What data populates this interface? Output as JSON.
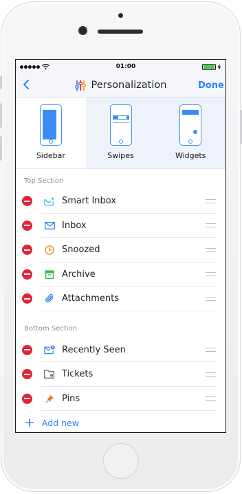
{
  "status": {
    "time": "01:00"
  },
  "nav": {
    "back_icon": "chevron-left-icon",
    "title": "Personalization",
    "done": "Done"
  },
  "modes": [
    {
      "label": "Sidebar",
      "selected": true
    },
    {
      "label": "Swipes",
      "selected": false
    },
    {
      "label": "Widgets",
      "selected": false
    }
  ],
  "top_section": {
    "title": "Top Section",
    "items": [
      {
        "label": "Smart Inbox",
        "icon": "smart-inbox-icon",
        "color": "#2ec3e6"
      },
      {
        "label": "Inbox",
        "icon": "inbox-icon",
        "color": "#3d8bf5"
      },
      {
        "label": "Snoozed",
        "icon": "clock-icon",
        "color": "#f08a1c"
      },
      {
        "label": "Archive",
        "icon": "archive-icon",
        "color": "#2fbf4a"
      },
      {
        "label": "Attachments",
        "icon": "paperclip-icon",
        "color": "#3d8bf5"
      }
    ]
  },
  "bottom_section": {
    "title": "Bottom Section",
    "items": [
      {
        "label": "Recently Seen",
        "icon": "recently-seen-icon",
        "color": "#3d8bf5"
      },
      {
        "label": "Tickets",
        "icon": "folder-icon",
        "color": "#6b7280"
      },
      {
        "label": "Pins",
        "icon": "pin-icon",
        "color": "#f0772a"
      }
    ]
  },
  "add_new": "Add new",
  "colors": {
    "accent": "#2f82f4",
    "delete": "#e0253a"
  }
}
